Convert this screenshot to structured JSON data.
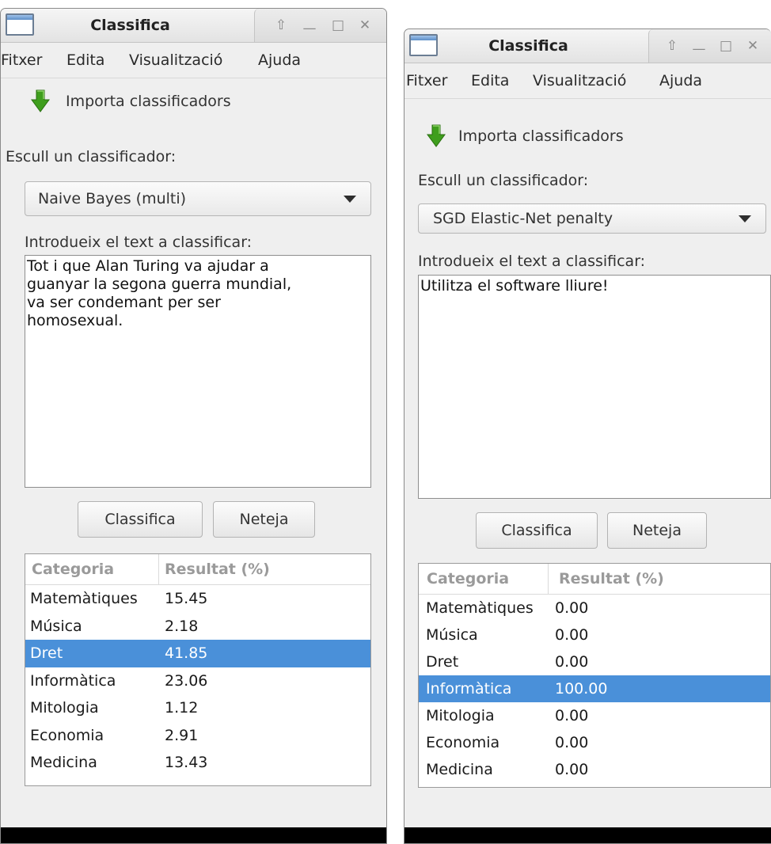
{
  "windows": [
    {
      "title": "Classifica",
      "menu": [
        "Fitxer",
        "Edita",
        "Visualització",
        "Ajuda"
      ],
      "import_label": "Importa classificadors",
      "choose_label": "Escull un classificador:",
      "selected_classifier": "Naive Bayes (multi)",
      "input_label": "Introdueix el text a classificar:",
      "input_text": "Tot i que Alan Turing va ajudar a\nguanyar la segona guerra mundial,\nva ser condemant per ser\nhomosexual.",
      "classify_button": "Classifica",
      "clear_button": "Neteja",
      "table": {
        "headers": [
          "Categoria",
          "Resultat (%)"
        ],
        "rows": [
          {
            "category": "Matemàtiques",
            "result": "15.45"
          },
          {
            "category": "Música",
            "result": "2.18"
          },
          {
            "category": "Dret",
            "result": "41.85"
          },
          {
            "category": "Informàtica",
            "result": "23.06"
          },
          {
            "category": "Mitologia",
            "result": "1.12"
          },
          {
            "category": "Economia",
            "result": "2.91"
          },
          {
            "category": "Medicina",
            "result": "13.43"
          }
        ],
        "selected_row": 2
      }
    },
    {
      "title": "Classifica",
      "menu": [
        "Fitxer",
        "Edita",
        "Visualització",
        "Ajuda"
      ],
      "import_label": "Importa classificadors",
      "choose_label": "Escull un classificador:",
      "selected_classifier": "SGD Elastic-Net penalty",
      "input_label": "Introdueix el text a classificar:",
      "input_text": "Utilitza el software lliure!",
      "classify_button": "Classifica",
      "clear_button": "Neteja",
      "table": {
        "headers": [
          "Categoria",
          "Resultat (%)"
        ],
        "rows": [
          {
            "category": "Matemàtiques",
            "result": "0.00"
          },
          {
            "category": "Música",
            "result": "0.00"
          },
          {
            "category": "Dret",
            "result": "0.00"
          },
          {
            "category": "Informàtica",
            "result": "100.00"
          },
          {
            "category": "Mitologia",
            "result": "0.00"
          },
          {
            "category": "Economia",
            "result": "0.00"
          },
          {
            "category": "Medicina",
            "result": "0.00"
          }
        ],
        "selected_row": 3
      }
    }
  ],
  "colors": {
    "selection": "#4a90d9",
    "import_icon": "#3f9e1d",
    "header_text": "#9a9a9a"
  },
  "icons": {
    "window_icon": "window-icon",
    "import_icon": "green-down-arrow-icon",
    "controls": [
      "maximize-up-icon",
      "minimize-icon",
      "restore-icon",
      "close-icon"
    ]
  }
}
